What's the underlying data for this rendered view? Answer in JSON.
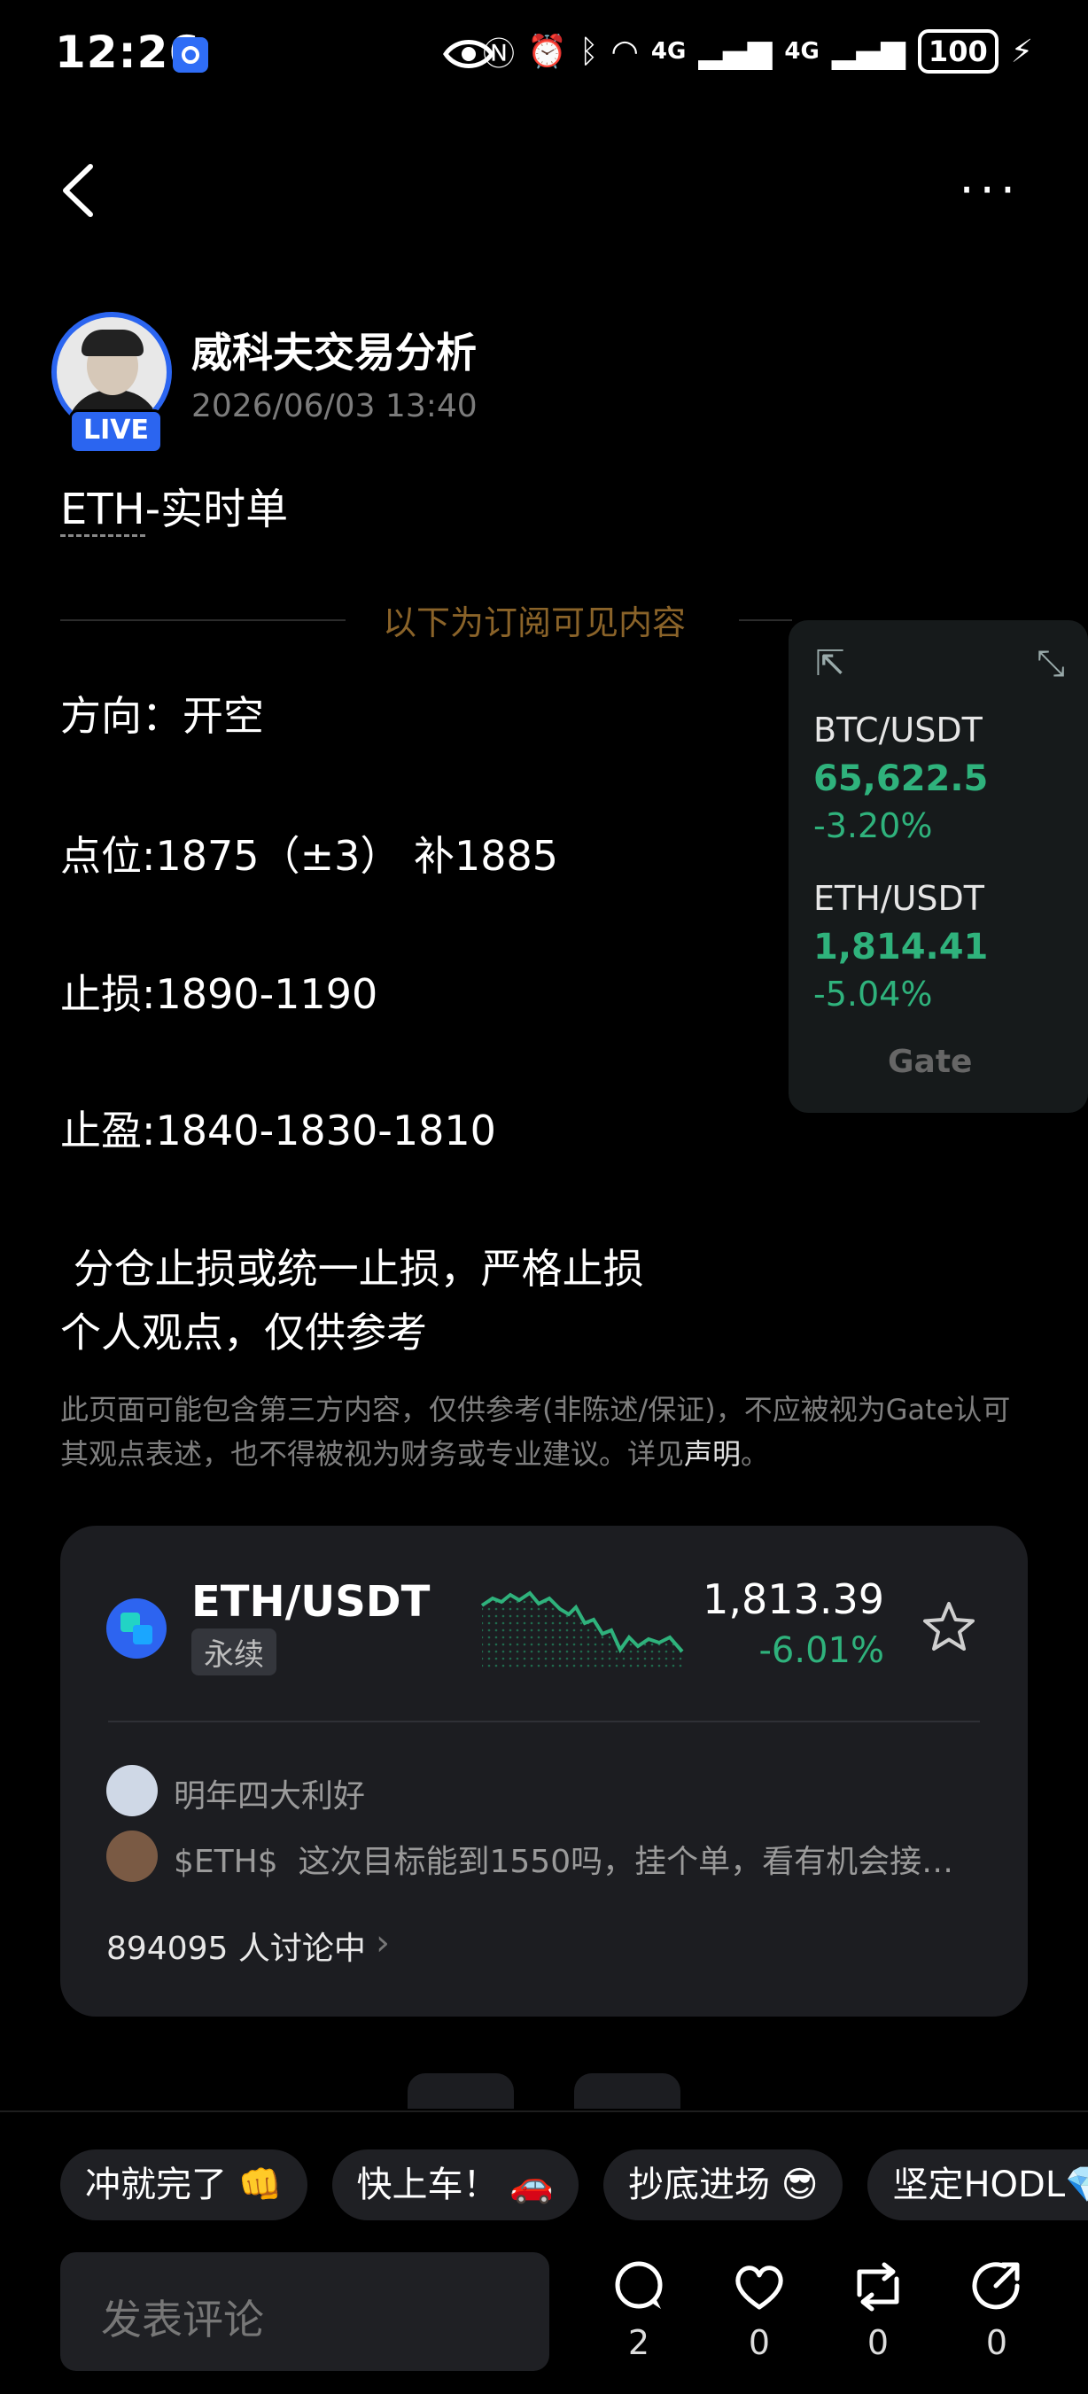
{
  "status_bar": {
    "time": "12:26",
    "battery": "100",
    "signal1": "4G",
    "signal2": "4G"
  },
  "author": {
    "name": "威科夫交易分析",
    "date": "2026/06/03 13:40",
    "live_label": "LIVE"
  },
  "post": {
    "title_ticker": "ETH",
    "title_rest": "-实时单",
    "divider_text": "以下为订阅可见内容",
    "lines": [
      "方向：开空",
      "点位:1875（±3） 补1885",
      "止损:1890-1190",
      "止盈:1840-1830-1810",
      " 分仓止损或统一止损，严格止损",
      "个人观点，仅供参考"
    ]
  },
  "widget": {
    "items": [
      {
        "pair": "BTC/USDT",
        "price": "65,622.5",
        "change": "-3.20%"
      },
      {
        "pair": "ETH/USDT",
        "price": "1,814.41",
        "change": "-5.04%"
      }
    ],
    "brand": "Gate"
  },
  "disclaimer": {
    "text": "此页面可能包含第三方内容，仅供参考(非陈述/保证)，不应被视为Gate认可其观点表述，也不得被视为财务或专业建议。详见",
    "link": "声明",
    "end": "。"
  },
  "market_card": {
    "pair": "ETH/USDT",
    "tag": "永续",
    "price": "1,813.39",
    "change": "-6.01%",
    "comments": [
      {
        "text": "明年四大利好"
      },
      {
        "text": "$ETH$  这次目标能到1550吗，挂个单，看有机会接…"
      }
    ],
    "discussion_count": "894095 人讨论中"
  },
  "quick_replies": [
    "冲就完了 👊",
    "快上车！ 🚗",
    "抄底进场 😎",
    "坚定HODL💎"
  ],
  "comment_input": {
    "placeholder": "发表评论"
  },
  "actions": {
    "comments": "2",
    "likes": "0",
    "reposts": "0",
    "shares": "0"
  },
  "colors": {
    "accent_blue": "#2b65f0",
    "green": "#2fb27c",
    "gold": "#8a6329"
  }
}
